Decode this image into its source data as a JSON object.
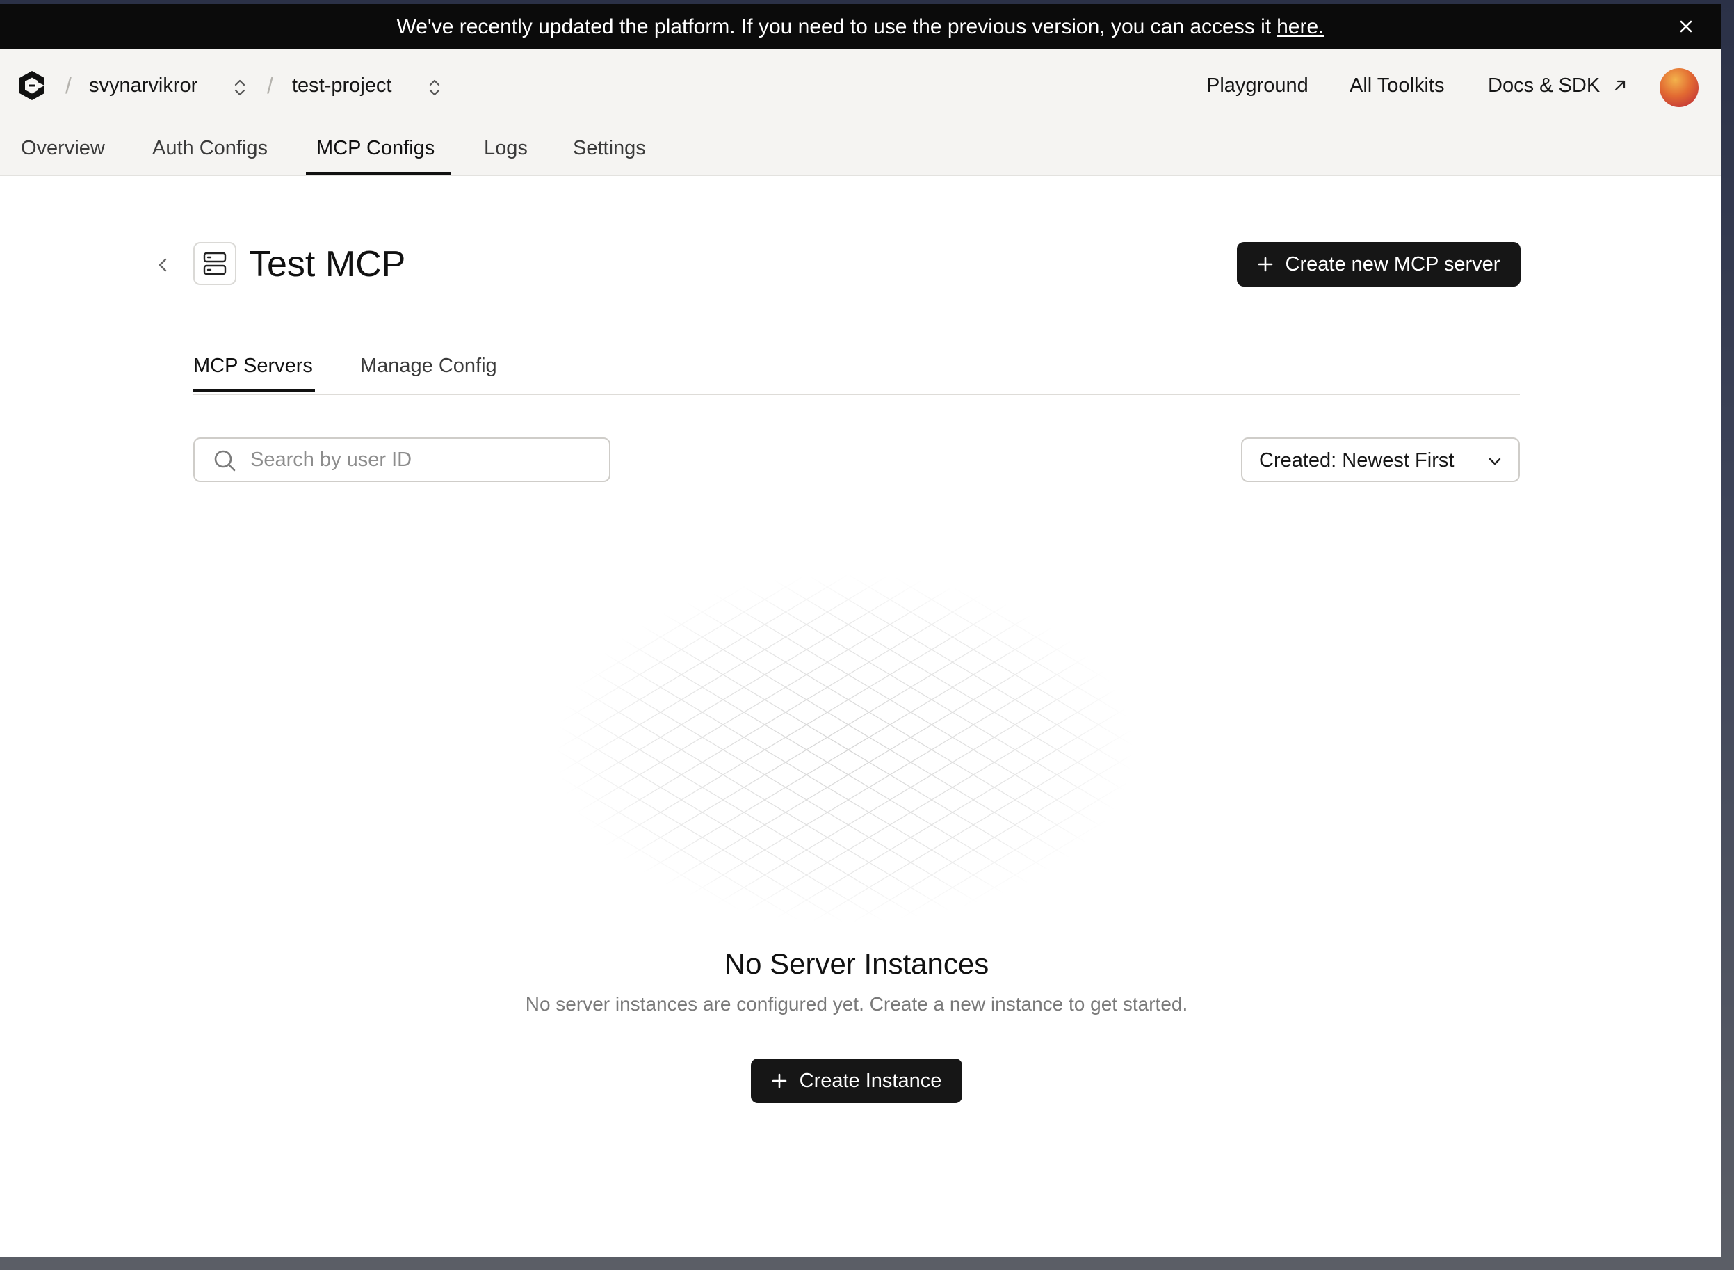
{
  "banner": {
    "message": "We've recently updated the platform. If you need to use the previous version, you can access it",
    "link_text": "here.",
    "close_icon": "close-icon"
  },
  "header": {
    "logo_icon": "composio-logo-icon",
    "breadcrumbs": [
      {
        "label": "svynarvikror"
      },
      {
        "label": "test-project"
      }
    ],
    "nav_links": {
      "playground": "Playground",
      "all_toolkits": "All Toolkits",
      "docs_sdk": "Docs & SDK"
    },
    "tabs": [
      {
        "label": "Overview"
      },
      {
        "label": "Auth Configs"
      },
      {
        "label": "MCP Configs"
      },
      {
        "label": "Logs"
      },
      {
        "label": "Settings"
      }
    ],
    "active_tab": "MCP Configs"
  },
  "page": {
    "title": "Test MCP",
    "create_server_label": "Create new MCP server",
    "subtabs": [
      {
        "label": "MCP Servers"
      },
      {
        "label": "Manage Config"
      }
    ],
    "active_subtab": "MCP Servers",
    "search": {
      "placeholder": "Search by user ID",
      "value": ""
    },
    "sort": {
      "selected": "Created: Newest First"
    },
    "empty_state": {
      "title": "No Server Instances",
      "description": "No server instances are configured yet. Create a new instance to get started.",
      "button_label": "Create Instance"
    }
  },
  "colors": {
    "banner_bg": "#0b0b0b",
    "header_bg": "#f5f4f2",
    "primary_button": "#161616",
    "muted_text": "#7a7a7a"
  }
}
